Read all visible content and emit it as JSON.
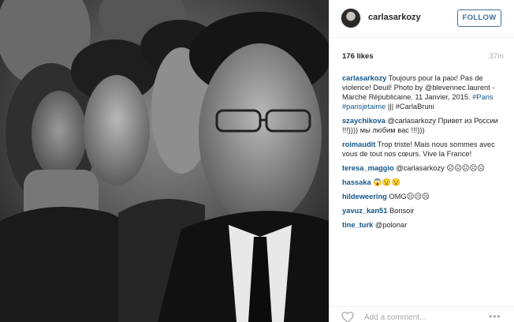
{
  "post": {
    "username": "carlasarkozy",
    "follow_label": "FOLLOW",
    "likes": "176 likes",
    "time": "37m",
    "caption": {
      "user": "carlasarkozy",
      "text": " Toujours pour la paix! Pas de violence! Deuil! Photo by @blevennec.laurent - Marche Républicaine. 11 Janvier, 2015. ",
      "hashtags": "#Paris #parisjetaime",
      "text_end": " ||| #CarlaBruni"
    },
    "comments": [
      {
        "user": "szaychikova",
        "text": " @carlasarkozy Привет из России !!!)))) мы любим вас !!!)))"
      },
      {
        "user": "roimaudit",
        "text": " Trop triste! Mais nous sommes avec vous de tout nos cœurs. Vive la France!"
      },
      {
        "user": "teresa_maggio",
        "text": " @carlasarkozy ☹☹☹☹☹"
      },
      {
        "user": "hassaka",
        "text": " 😱😟😟"
      },
      {
        "user": "hildeweering",
        "text": " OMG☹☹☹"
      },
      {
        "user": "yavuz_kan51",
        "text": " Bonsoir"
      },
      {
        "user": "tine_turk",
        "text": " @polonar"
      }
    ],
    "add_comment_placeholder": "Add a comment...",
    "more_label": "•••"
  },
  "colors": {
    "link": "#125688",
    "follow": "#3f729b",
    "muted": "#a5a7aa"
  },
  "icons": {
    "like": "heart-icon",
    "options": "more-options-icon"
  }
}
